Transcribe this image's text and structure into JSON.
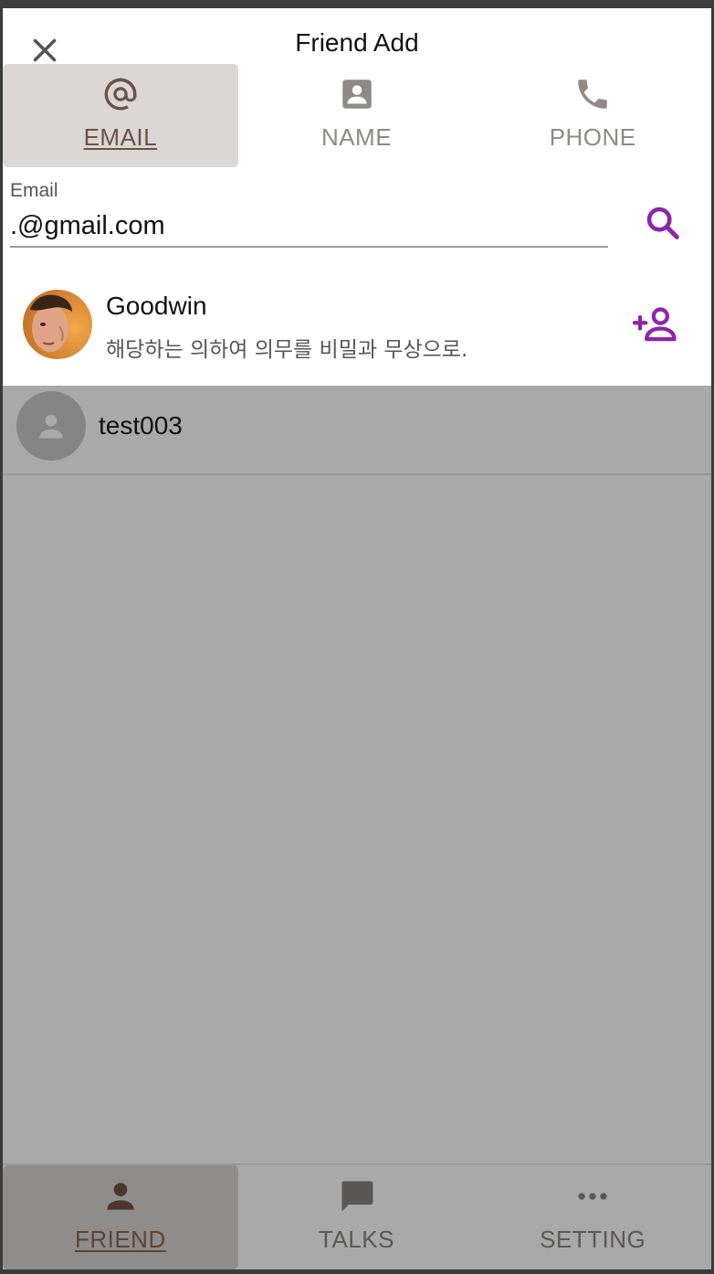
{
  "dialog": {
    "title": "Friend Add",
    "tabs": [
      {
        "label": "EMAIL",
        "icon": "at-icon",
        "active": true
      },
      {
        "label": "NAME",
        "icon": "contact-card-icon",
        "active": false
      },
      {
        "label": "PHONE",
        "icon": "phone-icon",
        "active": false
      }
    ],
    "field": {
      "label": "Email",
      "value": ".@gmail.com"
    },
    "result": {
      "name": "Goodwin",
      "message": "해당하는 의하여 의무를 비밀과 무상으로."
    }
  },
  "friends": [
    {
      "name": "test003"
    }
  ],
  "bottom_nav": [
    {
      "label": "FRIEND",
      "icon": "person-icon",
      "active": true
    },
    {
      "label": "TALKS",
      "icon": "chat-bubble-icon",
      "active": false
    },
    {
      "label": "SETTING",
      "icon": "more-dots-icon",
      "active": false
    }
  ],
  "colors": {
    "accent": "#8e24aa",
    "active_tab_bg": "#dbd7d4",
    "active_label": "#6b5345",
    "overlay_bg": "#a9a9a9"
  }
}
